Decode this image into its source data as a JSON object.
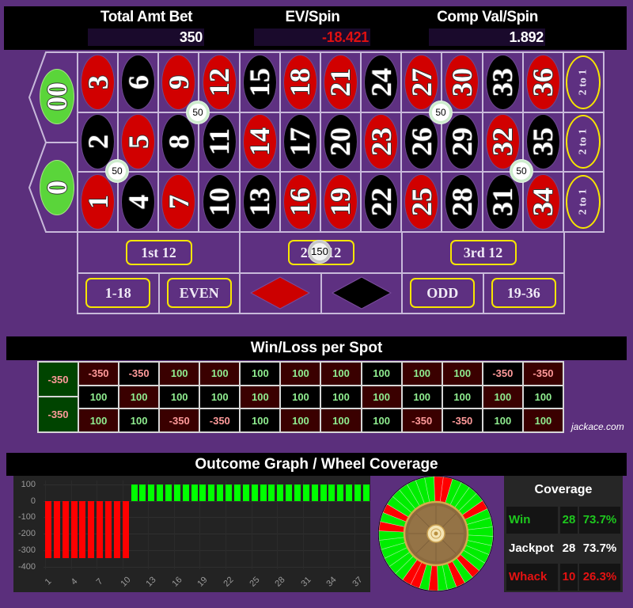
{
  "header": {
    "stats": [
      {
        "label": "Total Amt Bet",
        "value": "350",
        "value_color": "#ffffff"
      },
      {
        "label": "EV/Spin",
        "value": "-18.421",
        "value_color": "#e01010"
      },
      {
        "label": "Comp Val/Spin",
        "value": "1.892",
        "value_color": "#ffffff"
      }
    ]
  },
  "colors": {
    "red_spot": "#d10000",
    "black_spot": "#000000",
    "zero_spot": "#5ad53a",
    "win_text": "#90ee90",
    "loss_text": "#ff9a9a",
    "win_bar": "#00ff00",
    "loss_bar": "#ff0000",
    "wheel_win": "#00ee00",
    "wheel_loss": "#ff0000"
  },
  "board": {
    "zeros": [
      "00",
      "0"
    ],
    "rows": [
      [
        "3",
        "6",
        "9",
        "12",
        "15",
        "18",
        "21",
        "24",
        "27",
        "30",
        "33",
        "36"
      ],
      [
        "2",
        "5",
        "8",
        "11",
        "14",
        "17",
        "20",
        "23",
        "26",
        "29",
        "32",
        "35"
      ],
      [
        "1",
        "4",
        "7",
        "10",
        "13",
        "16",
        "19",
        "22",
        "25",
        "28",
        "31",
        "34"
      ]
    ],
    "red_numbers": [
      "1",
      "3",
      "5",
      "7",
      "9",
      "12",
      "14",
      "16",
      "18",
      "19",
      "21",
      "23",
      "25",
      "27",
      "30",
      "32",
      "34",
      "36"
    ],
    "column_bets": [
      "2 to 1",
      "2 to 1",
      "2 to 1"
    ],
    "dozens": [
      "1st 12",
      "2nd 12",
      "3rd 12"
    ],
    "outside": [
      {
        "label": "1-18"
      },
      {
        "label": "EVEN"
      },
      {
        "label": "",
        "icon": "red-diamond"
      },
      {
        "label": "",
        "icon": "black-diamond"
      },
      {
        "label": "ODD"
      },
      {
        "label": "19-36"
      }
    ],
    "chips": [
      {
        "bet": "corner 8-9-11-12",
        "amount": "50"
      },
      {
        "bet": "corner 1-2-4-5",
        "amount": "50"
      },
      {
        "bet": "corner 26-27-29-30",
        "amount": "50"
      },
      {
        "bet": "corner 31-32-34-35",
        "amount": "50"
      },
      {
        "bet": "2nd 12",
        "amount": "150"
      }
    ]
  },
  "winloss": {
    "title": "Win/Loss per Spot",
    "zeros": [
      "-350",
      "-350"
    ],
    "rows": [
      [
        "-350",
        "-350",
        "100",
        "100",
        "100",
        "100",
        "100",
        "100",
        "100",
        "100",
        "-350",
        "-350"
      ],
      [
        "100",
        "100",
        "100",
        "100",
        "100",
        "100",
        "100",
        "100",
        "100",
        "100",
        "100",
        "100"
      ],
      [
        "100",
        "100",
        "-350",
        "-350",
        "100",
        "100",
        "100",
        "100",
        "-350",
        "-350",
        "100",
        "100"
      ]
    ]
  },
  "watermark": "jackace.com",
  "outcome": {
    "title": "Outcome Graph / Wheel Coverage"
  },
  "chart_data": {
    "type": "bar",
    "title": "",
    "xlabel": "",
    "ylabel": "",
    "x": [
      1,
      2,
      3,
      4,
      5,
      6,
      7,
      8,
      9,
      10,
      11,
      12,
      13,
      14,
      15,
      16,
      17,
      18,
      19,
      20,
      21,
      22,
      23,
      24,
      25,
      26,
      27,
      28,
      29,
      30,
      31,
      32,
      33,
      34,
      35,
      36,
      37,
      38
    ],
    "values": [
      -350,
      -350,
      -350,
      -350,
      -350,
      -350,
      -350,
      -350,
      -350,
      -350,
      100,
      100,
      100,
      100,
      100,
      100,
      100,
      100,
      100,
      100,
      100,
      100,
      100,
      100,
      100,
      100,
      100,
      100,
      100,
      100,
      100,
      100,
      100,
      100,
      100,
      100,
      100,
      100
    ],
    "x_ticks": [
      1,
      4,
      7,
      10,
      13,
      16,
      19,
      22,
      25,
      28,
      31,
      34,
      37
    ],
    "y_ticks": [
      100,
      0,
      -100,
      -200,
      -300,
      -400
    ],
    "ylim": [
      -400,
      100
    ],
    "grid": true,
    "legend": "none"
  },
  "wheel": {
    "order": [
      "0",
      "28",
      "9",
      "26",
      "30",
      "11",
      "7",
      "20",
      "32",
      "17",
      "5",
      "22",
      "34",
      "15",
      "3",
      "24",
      "36",
      "13",
      "1",
      "00",
      "27",
      "10",
      "25",
      "29",
      "12",
      "8",
      "19",
      "31",
      "18",
      "6",
      "21",
      "33",
      "16",
      "4",
      "23",
      "35",
      "14",
      "2"
    ],
    "losing": [
      "0",
      "00",
      "3",
      "6",
      "7",
      "10",
      "25",
      "28",
      "33",
      "36"
    ]
  },
  "coverage": {
    "title": "Coverage",
    "rows": [
      {
        "label": "Win",
        "count": "28",
        "pct": "73.7%",
        "color": "#1ec81e"
      },
      {
        "label": "Jackpot",
        "count": "28",
        "pct": "73.7%",
        "color": "#ffffff"
      },
      {
        "label": "Whack",
        "count": "10",
        "pct": "26.3%",
        "color": "#e51212"
      }
    ]
  }
}
